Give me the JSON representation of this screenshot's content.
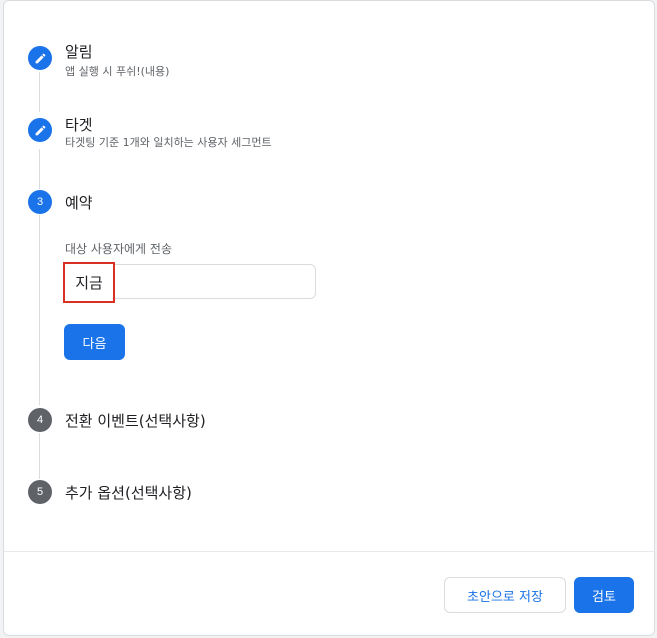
{
  "steps": [
    {
      "number": "",
      "icon": "pencil-icon",
      "title": "알림",
      "subtitle": "앱 실행 시 푸쉬!(내용)",
      "status": "done"
    },
    {
      "number": "",
      "icon": "pencil-icon",
      "title": "타겟",
      "subtitle": "타겟팅 기준 1개와 일치하는 사용자 세그먼트",
      "status": "done"
    },
    {
      "number": "3",
      "title": "예약",
      "status": "active"
    },
    {
      "number": "4",
      "title": "전환 이벤트(선택사항)",
      "status": "pending"
    },
    {
      "number": "5",
      "title": "추가 옵션(선택사항)",
      "status": "pending"
    }
  ],
  "schedule": {
    "label": "대상 사용자에게 전송",
    "selected_value": "지금",
    "next_button": "다음"
  },
  "footer": {
    "save_draft_button": "초안으로 저장",
    "review_button": "검토"
  },
  "colors": {
    "accent": "#1a73e8",
    "highlight": "#d93025",
    "pending_step": "#5f6368"
  }
}
